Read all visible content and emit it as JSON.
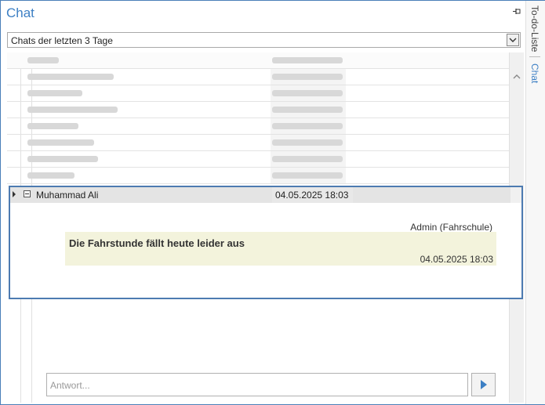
{
  "panel": {
    "title": "Chat"
  },
  "side_tabs": {
    "todo": "To-do-Liste",
    "chat": "Chat"
  },
  "filter": {
    "selected": "Chats der letzten 3 Tage"
  },
  "grid": {
    "blurred_rows": 8,
    "group": {
      "name": "Muhammad Ali",
      "date": "04.05.2025 18:03"
    },
    "message": {
      "sender": "Admin (Fahrschule)",
      "text": "Die Fahrstunde fällt heute leider aus",
      "time": "04.05.2025 18:03"
    }
  },
  "reply": {
    "placeholder": "Antwort..."
  },
  "colors": {
    "accent": "#3c7fc4",
    "bubble": "#f3f3dc",
    "group_row": "#e4e4e4"
  },
  "icons": {
    "pin": "pin-icon",
    "dropdown": "chevron-down-icon",
    "send": "play-icon",
    "scroll_up": "chevron-up-icon"
  }
}
